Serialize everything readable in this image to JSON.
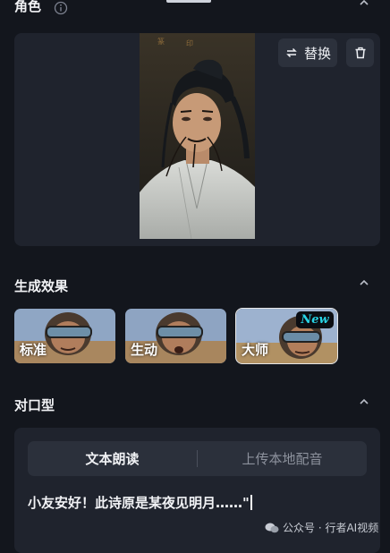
{
  "role_section": {
    "title": "角色",
    "replace_label": "替换"
  },
  "effect_section": {
    "title": "生成效果",
    "options": [
      {
        "label": "标准",
        "selected": false
      },
      {
        "label": "生动",
        "selected": false
      },
      {
        "label": "大师",
        "selected": true,
        "badge": "New"
      }
    ]
  },
  "lip_section": {
    "title": "对口型",
    "tabs": [
      {
        "label": "文本朗读",
        "active": true
      },
      {
        "label": "上传本地配音",
        "active": false
      }
    ],
    "text": "小友安好！此诗原是某夜见明月……\""
  },
  "watermark": {
    "text": "公众号 · 行者AI视频"
  },
  "colors": {
    "background": "#13161d",
    "card": "#1f232d",
    "badge_text": "#28d4e6"
  }
}
